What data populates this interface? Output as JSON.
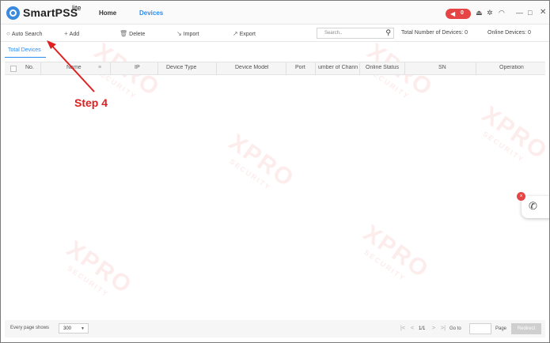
{
  "app": {
    "name": "SmartPSS",
    "name_suffix": "lite",
    "nav": {
      "home": "Home",
      "devices": "Devices"
    },
    "notification_count": "0",
    "controls": {
      "minimize": "—",
      "maximize": "□",
      "close": "✕"
    }
  },
  "toolbar": {
    "auto_search": "Auto Search",
    "add": "Add",
    "delete": "Delete",
    "import": "Import",
    "export": "Export",
    "search_placeholder": "Search..",
    "total_devices_label": "Total Number of Devices: 0",
    "online_devices_label": "Online Devices: 0"
  },
  "subtabs": {
    "total_devices": "Total Devices"
  },
  "table": {
    "columns": [
      "No.",
      "Name",
      "IP",
      "Device Type",
      "Device Model",
      "Port",
      "umber of Chann",
      "Online Status",
      "SN",
      "Operation"
    ],
    "rows": []
  },
  "footer": {
    "every_page_shows": "Every page shows",
    "page_size": "300",
    "page_indicator": "1/1",
    "go_to": "Go to",
    "page": "Page",
    "redirect": "Redirect"
  },
  "annotation": {
    "label": "Step 4",
    "color": "#e02020"
  },
  "watermark": {
    "brand": "XPRO",
    "tagline": "SECURITY"
  },
  "colors": {
    "accent": "#2e8cf0",
    "alert": "#e64545"
  }
}
